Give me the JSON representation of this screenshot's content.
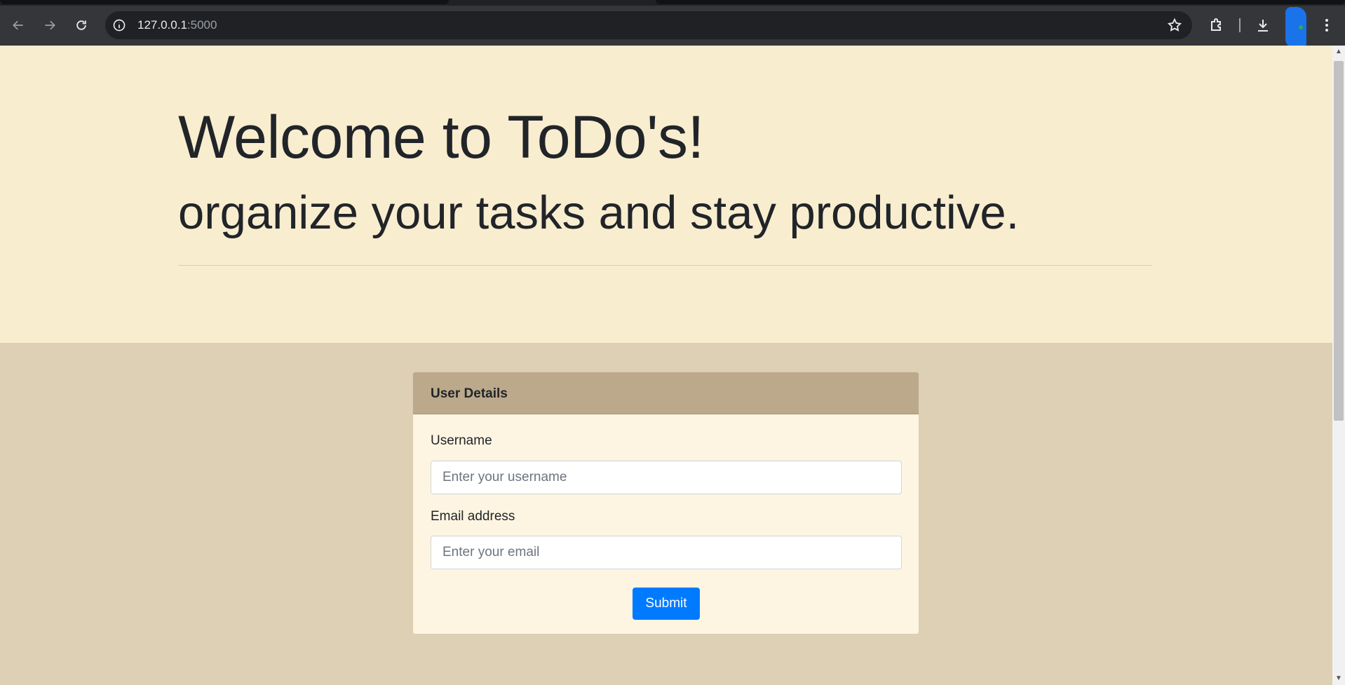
{
  "browser": {
    "url_host": "127.0.0.1",
    "url_port": ":5000",
    "icons": {
      "back": "arrow-left-icon",
      "forward": "arrow-right-icon",
      "reload": "reload-icon",
      "info": "info-icon",
      "bookmark": "star-icon",
      "extensions": "puzzle-icon",
      "downloads": "download-icon",
      "menu": "kebab-menu-icon"
    }
  },
  "hero": {
    "title": "Welcome to ToDo's!",
    "subtitle": "organize your tasks and stay productive."
  },
  "form": {
    "header": "User Details",
    "username_label": "Username",
    "username_placeholder": "Enter your username",
    "username_value": "",
    "email_label": "Email address",
    "email_placeholder": "Enter your email",
    "email_value": "",
    "submit_label": "Submit"
  },
  "colors": {
    "hero_bg": "#f9edcf",
    "page_bg": "#ddd0b4",
    "card_header_bg": "#bca98b",
    "card_body_bg": "#fdf5e2",
    "submit_bg": "#007bff"
  }
}
